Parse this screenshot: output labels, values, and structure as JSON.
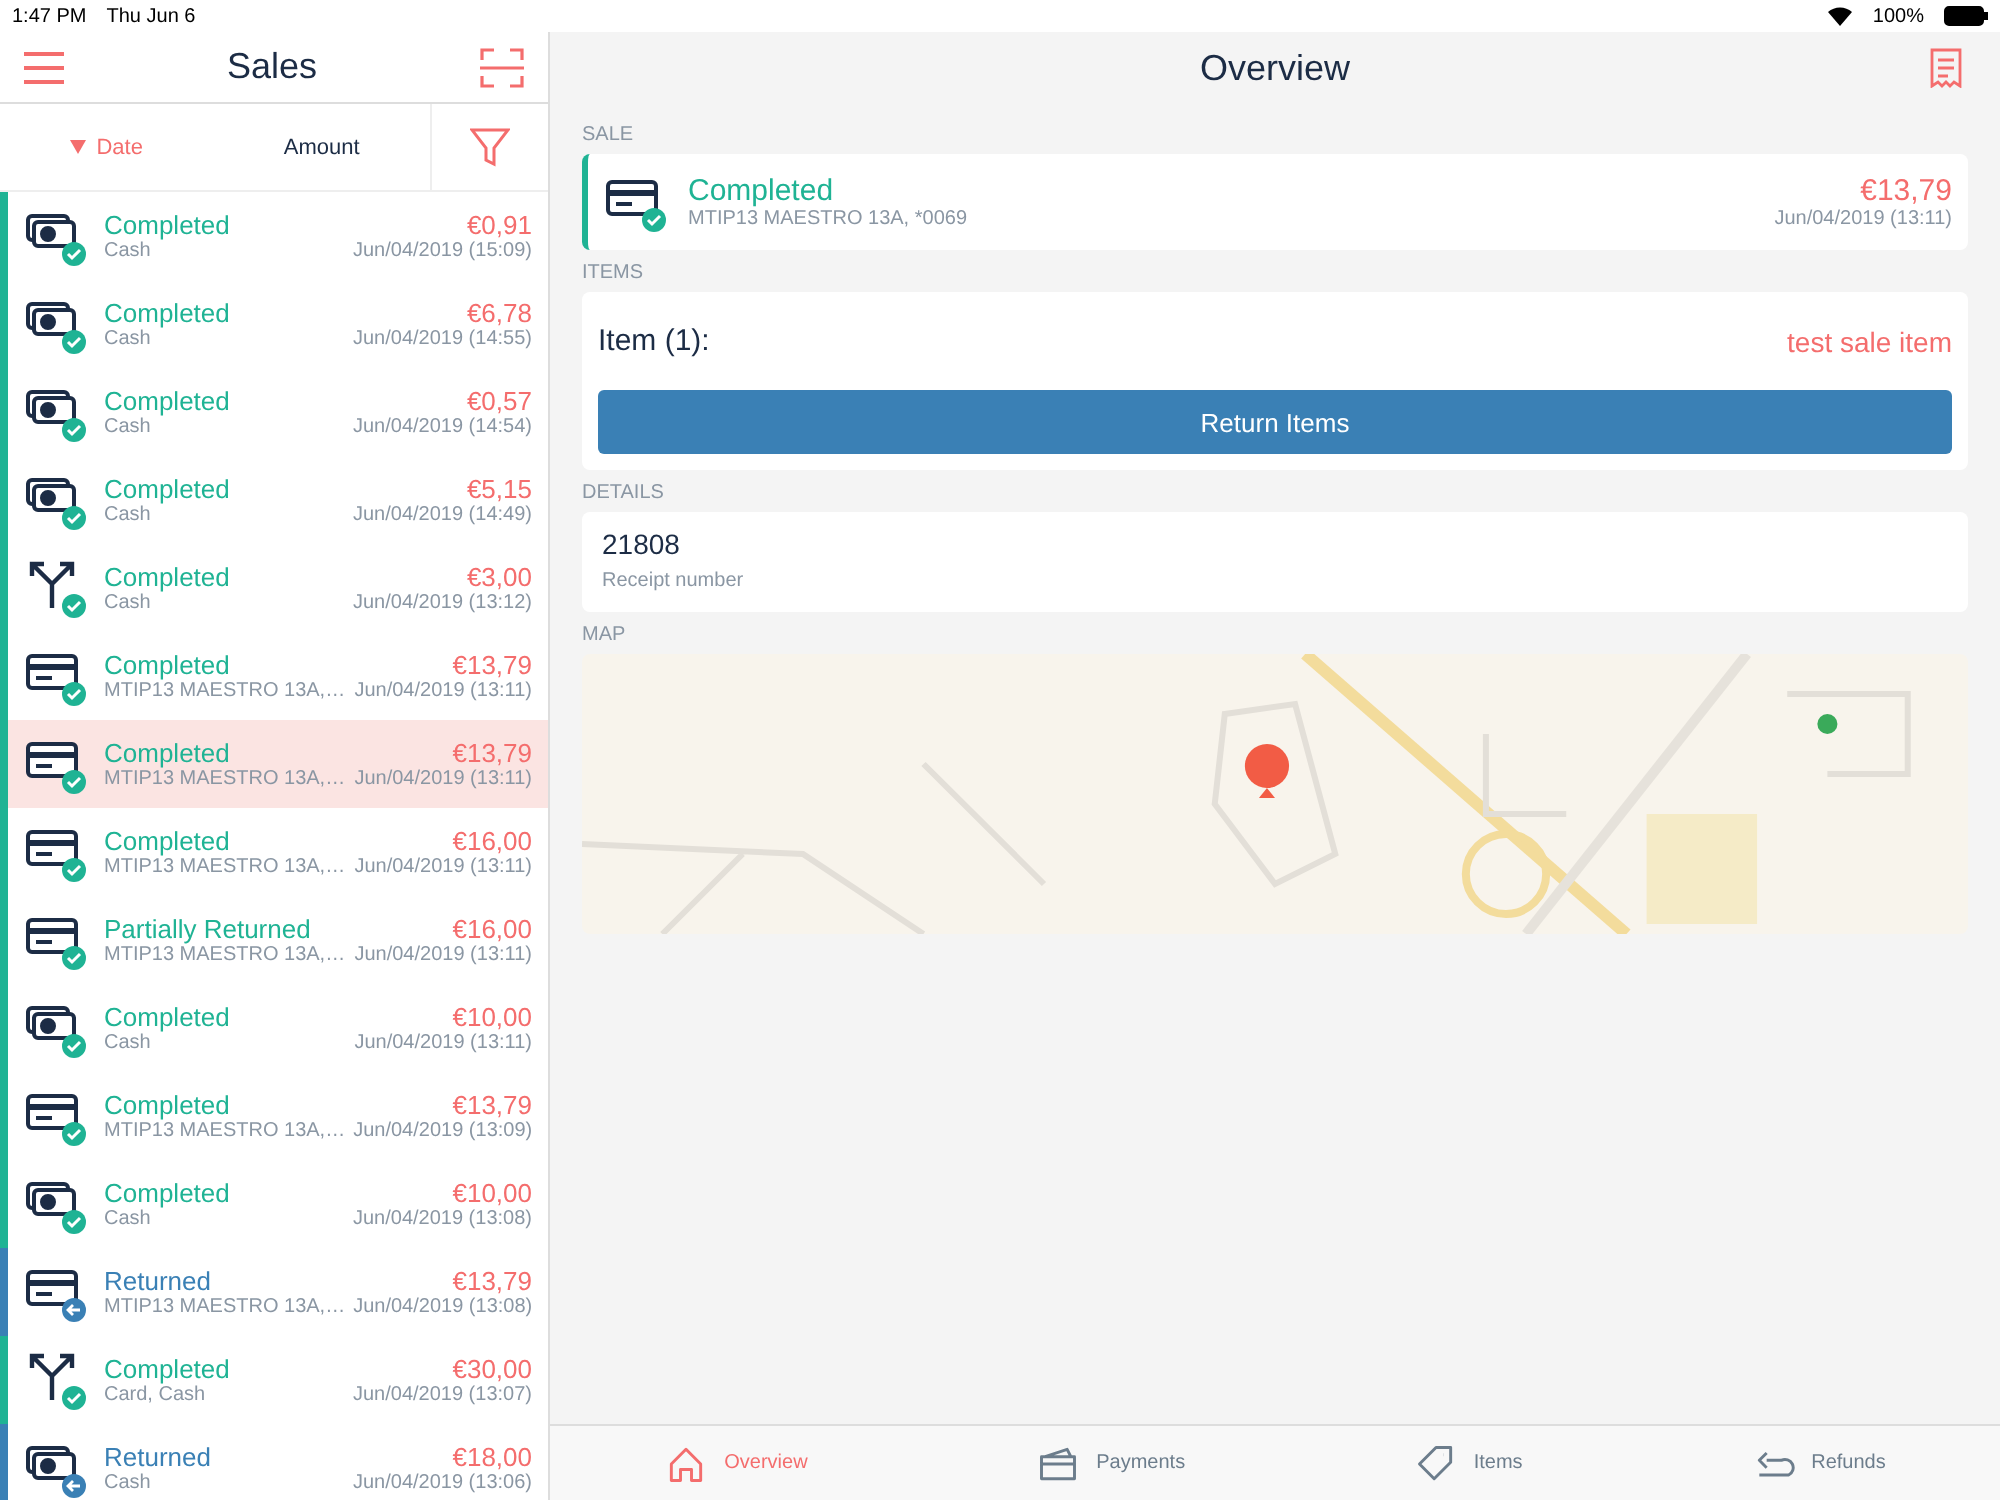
{
  "status_bar": {
    "time": "1:47 PM",
    "date": "Thu Jun 6",
    "battery": "100%"
  },
  "sidebar": {
    "title": "Sales",
    "sort": [
      {
        "label": "Date",
        "selected": true
      },
      {
        "label": "Amount",
        "selected": false
      }
    ],
    "sales": [
      {
        "kind": "cash",
        "status": "Completed",
        "returned": false,
        "method": "Cash",
        "amount": "€0,91",
        "date": "Jun/04/2019 (15:09)",
        "selected": false
      },
      {
        "kind": "cash",
        "status": "Completed",
        "returned": false,
        "method": "Cash",
        "amount": "€6,78",
        "date": "Jun/04/2019 (14:55)",
        "selected": false
      },
      {
        "kind": "cash",
        "status": "Completed",
        "returned": false,
        "method": "Cash",
        "amount": "€0,57",
        "date": "Jun/04/2019 (14:54)",
        "selected": false
      },
      {
        "kind": "cash",
        "status": "Completed",
        "returned": false,
        "method": "Cash",
        "amount": "€5,15",
        "date": "Jun/04/2019 (14:49)",
        "selected": false
      },
      {
        "kind": "split",
        "status": "Completed",
        "returned": false,
        "method": "Cash",
        "amount": "€3,00",
        "date": "Jun/04/2019 (13:12)",
        "selected": false
      },
      {
        "kind": "card",
        "status": "Completed",
        "returned": false,
        "method": "MTIP13 MAESTRO 13A,…",
        "amount": "€13,79",
        "date": "Jun/04/2019 (13:11)",
        "selected": false
      },
      {
        "kind": "card",
        "status": "Completed",
        "returned": false,
        "method": "MTIP13 MAESTRO 13A,…",
        "amount": "€13,79",
        "date": "Jun/04/2019 (13:11)",
        "selected": true
      },
      {
        "kind": "card",
        "status": "Completed",
        "returned": false,
        "method": "MTIP13 MAESTRO 13A,…",
        "amount": "€16,00",
        "date": "Jun/04/2019 (13:11)",
        "selected": false
      },
      {
        "kind": "card",
        "status": "Partially Returned",
        "returned": false,
        "method": "MTIP13 MAESTRO 13A,…",
        "amount": "€16,00",
        "date": "Jun/04/2019 (13:11)",
        "selected": false
      },
      {
        "kind": "cash",
        "status": "Completed",
        "returned": false,
        "method": "Cash",
        "amount": "€10,00",
        "date": "Jun/04/2019 (13:11)",
        "selected": false
      },
      {
        "kind": "card",
        "status": "Completed",
        "returned": false,
        "method": "MTIP13 MAESTRO 13A,…",
        "amount": "€13,79",
        "date": "Jun/04/2019 (13:09)",
        "selected": false
      },
      {
        "kind": "cash",
        "status": "Completed",
        "returned": false,
        "method": "Cash",
        "amount": "€10,00",
        "date": "Jun/04/2019 (13:08)",
        "selected": false
      },
      {
        "kind": "card",
        "status": "Returned",
        "returned": true,
        "method": "MTIP13 MAESTRO 13A,…",
        "amount": "€13,79",
        "date": "Jun/04/2019 (13:08)",
        "selected": false
      },
      {
        "kind": "split",
        "status": "Completed",
        "returned": false,
        "method": "Card, Cash",
        "amount": "€30,00",
        "date": "Jun/04/2019 (13:07)",
        "selected": false
      },
      {
        "kind": "cash",
        "status": "Returned",
        "returned": true,
        "method": "Cash",
        "amount": "€18,00",
        "date": "Jun/04/2019 (13:06)",
        "selected": false
      }
    ]
  },
  "detail": {
    "title": "Overview",
    "sale_label": "SALE",
    "sale": {
      "kind": "card",
      "status": "Completed",
      "returned": false,
      "method": "MTIP13 MAESTRO 13A, *0069",
      "amount": "€13,79",
      "date": "Jun/04/2019 (13:11)"
    },
    "items_label": "ITEMS",
    "item_title": "Item (1):",
    "item_name": "test sale item",
    "return_button": "Return Items",
    "details_label": "DETAILS",
    "receipt_number": "21808",
    "receipt_caption": "Receipt number",
    "map_label": "MAP"
  },
  "tab_bar": [
    {
      "kind": "home",
      "label": "Overview",
      "selected": true
    },
    {
      "kind": "card",
      "label": "Payments",
      "selected": false
    },
    {
      "kind": "tag",
      "label": "Items",
      "selected": false
    },
    {
      "kind": "refund",
      "label": "Refunds",
      "selected": false
    }
  ]
}
